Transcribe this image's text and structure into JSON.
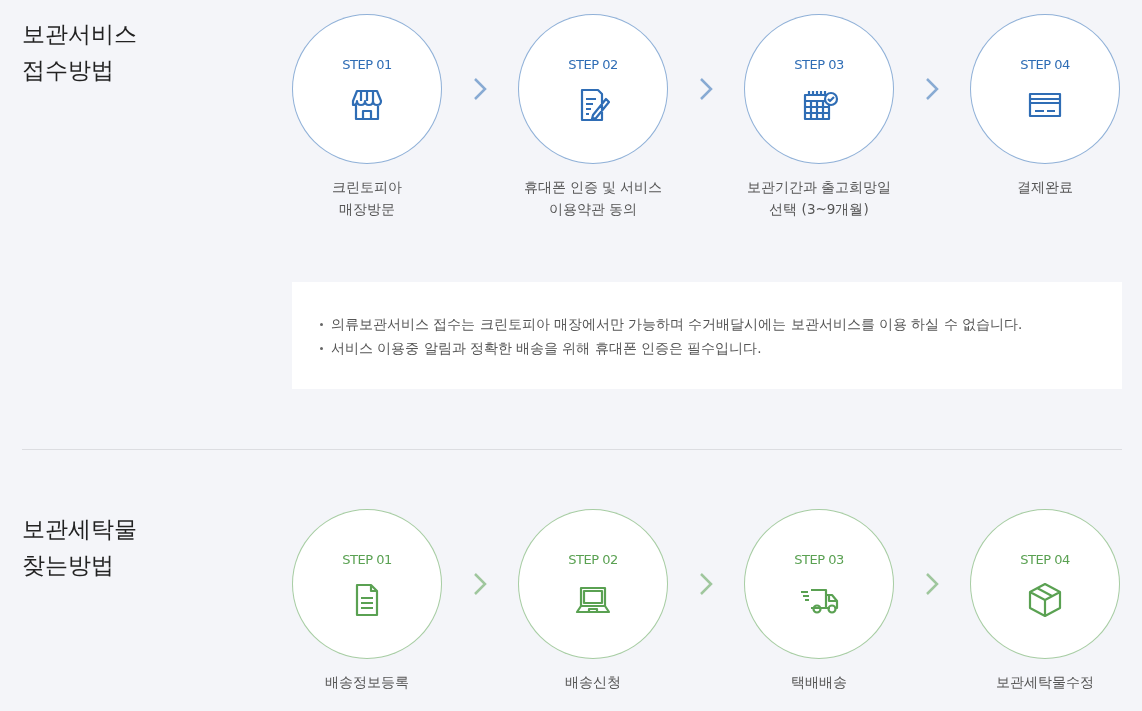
{
  "sections": [
    {
      "title": "보관서비스\n접수방법",
      "color": "#2f6db5",
      "steps": [
        {
          "step": "STEP 01",
          "kind": "store",
          "label": "크린토피아\n매장방문"
        },
        {
          "step": "STEP 02",
          "kind": "document-pen",
          "label": "휴대폰 인증 및 서비스\n이용약관 동의"
        },
        {
          "step": "STEP 03",
          "kind": "calendar",
          "label": "보관기간과 출고희망일\n선택 (3~9개월)"
        },
        {
          "step": "STEP 04",
          "kind": "card",
          "label": "결제완료"
        }
      ],
      "notes": [
        "의류보관서비스 접수는 크린토피아 매장에서만 가능하며 수거배달시에는 보관서비스를 이용 하실 수 없습니다.",
        "서비스 이용중 알림과 정확한 배송을 위해 휴대폰 인증은 필수입니다."
      ]
    },
    {
      "title": "보관세탁물\n찾는방법",
      "color": "#5aa152",
      "steps": [
        {
          "step": "STEP 01",
          "kind": "document",
          "label": "배송정보등록"
        },
        {
          "step": "STEP 02",
          "kind": "laptop",
          "label": "배송신청"
        },
        {
          "step": "STEP 03",
          "kind": "truck",
          "label": "택배배송"
        },
        {
          "step": "STEP 04",
          "kind": "box",
          "label": "보관세탁물수정"
        }
      ]
    }
  ]
}
